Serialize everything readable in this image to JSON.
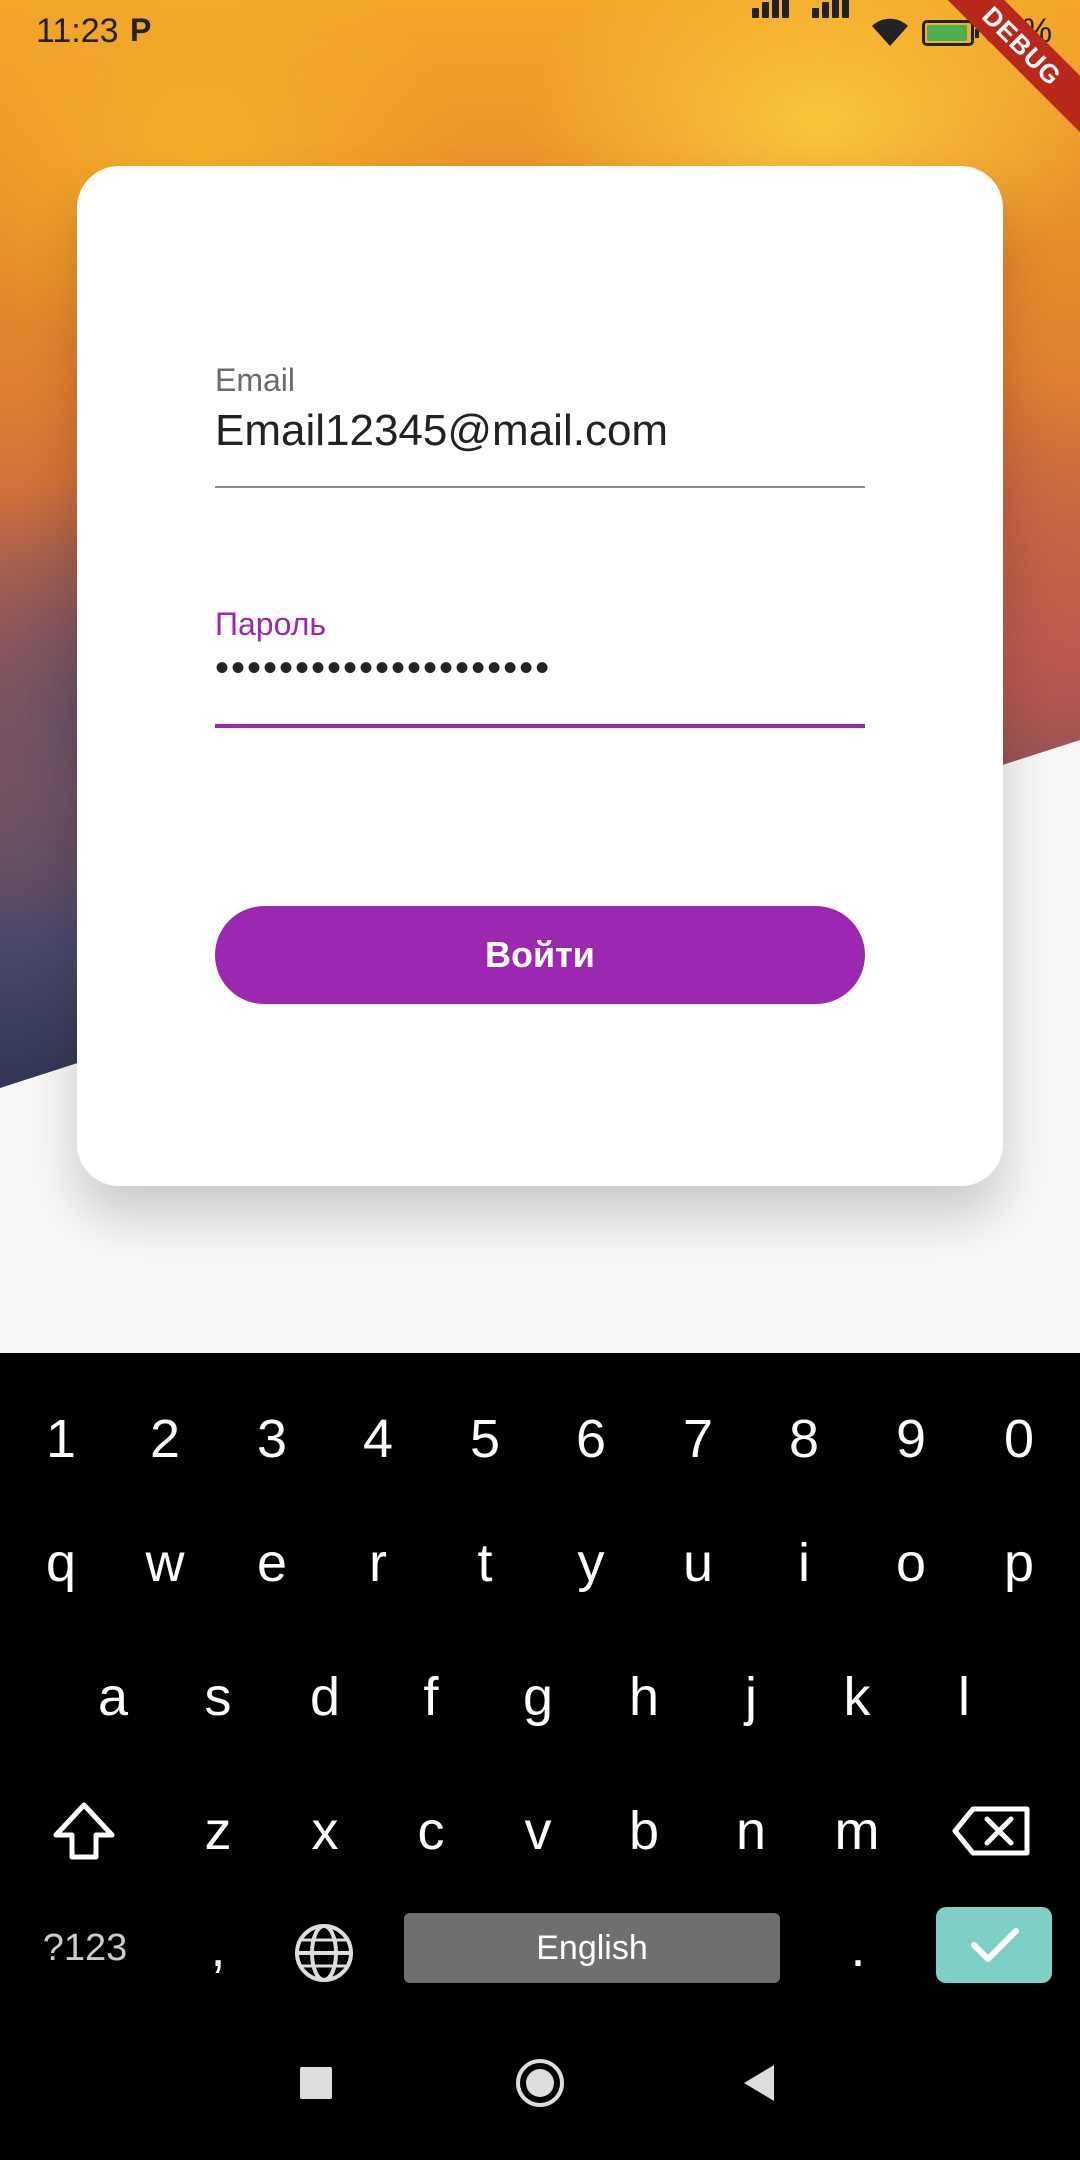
{
  "status_bar": {
    "time": "11:23",
    "notification_label": "P",
    "battery_percent": "95%",
    "debug_label": "DEBUG"
  },
  "login_form": {
    "email_label": "Email",
    "email_value": "Email12345@mail.com",
    "password_label": "Пароль",
    "password_value": "•••••••••••••••••••••",
    "login_button_label": "Войти"
  },
  "keyboard": {
    "digits": [
      "1",
      "2",
      "3",
      "4",
      "5",
      "6",
      "7",
      "8",
      "9",
      "0"
    ],
    "row_q": [
      "q",
      "w",
      "e",
      "r",
      "t",
      "y",
      "u",
      "i",
      "o",
      "p"
    ],
    "row_a": [
      "a",
      "s",
      "d",
      "f",
      "g",
      "h",
      "j",
      "k",
      "l"
    ],
    "row_z": [
      "z",
      "x",
      "c",
      "v",
      "b",
      "n",
      "m"
    ],
    "symbols_key": "?123",
    "comma_key": ",",
    "space_label": "English",
    "period_key": "."
  },
  "colors": {
    "accent": "#9c27b0",
    "enter_key": "#7ecfc5"
  }
}
